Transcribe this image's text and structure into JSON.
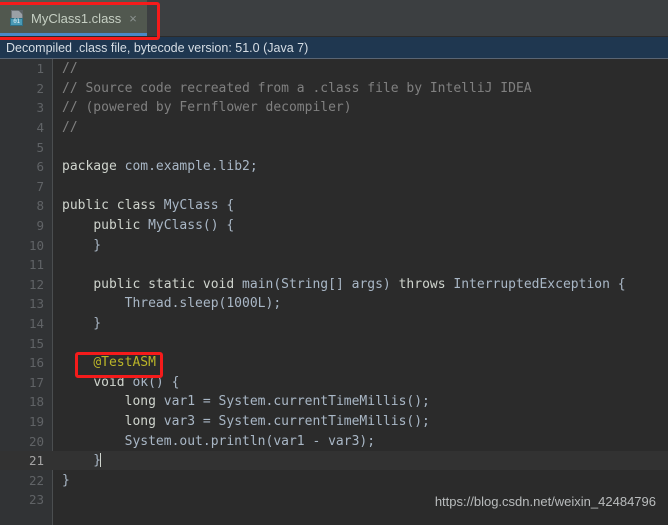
{
  "window": {
    "app": "IntelliJ IDEA",
    "editor_theme": "darcula"
  },
  "tabbar": {
    "tabs": [
      {
        "label": "MyClass1.class",
        "icon": "class-file-icon",
        "icon_badge": "01",
        "close_glyph": "×",
        "active": true
      }
    ]
  },
  "banner": {
    "text": "Decompiled .class file, bytecode version: 51.0 (Java 7)",
    "background": "#1f3750"
  },
  "editor": {
    "current_line": 21,
    "gutter_background": "#313335",
    "background": "#2b2b2b",
    "lines": [
      {
        "n": "1",
        "text": "//"
      },
      {
        "n": "2",
        "text": "// Source code recreated from a .class file by IntelliJ IDEA"
      },
      {
        "n": "3",
        "text": "// (powered by Fernflower decompiler)"
      },
      {
        "n": "4",
        "text": "//"
      },
      {
        "n": "5",
        "text": ""
      },
      {
        "n": "6",
        "text": "package com.example.lib2;"
      },
      {
        "n": "7",
        "text": ""
      },
      {
        "n": "8",
        "text": "public class MyClass {"
      },
      {
        "n": "9",
        "text": "    public MyClass() {"
      },
      {
        "n": "10",
        "text": "    }"
      },
      {
        "n": "11",
        "text": ""
      },
      {
        "n": "12",
        "text": "    public static void main(String[] args) throws InterruptedException {"
      },
      {
        "n": "13",
        "text": "        Thread.sleep(1000L);"
      },
      {
        "n": "14",
        "text": "    }"
      },
      {
        "n": "15",
        "text": ""
      },
      {
        "n": "16",
        "text": "    @TestASM"
      },
      {
        "n": "17",
        "text": "    void ok() {"
      },
      {
        "n": "18",
        "text": "        long var1 = System.currentTimeMillis();"
      },
      {
        "n": "19",
        "text": "        long var3 = System.currentTimeMillis();"
      },
      {
        "n": "20",
        "text": "        System.out.println(var1 - var3);"
      },
      {
        "n": "21",
        "text": "    }"
      },
      {
        "n": "22",
        "text": "}"
      },
      {
        "n": "23",
        "text": ""
      }
    ]
  },
  "annotations": {
    "boxes": [
      {
        "name": "tab-highlight",
        "color": "#f51b1b"
      },
      {
        "name": "annotation-highlight",
        "color": "#f51b1b"
      }
    ]
  },
  "watermark": {
    "text": "https://blog.csdn.net/weixin_42484796"
  }
}
